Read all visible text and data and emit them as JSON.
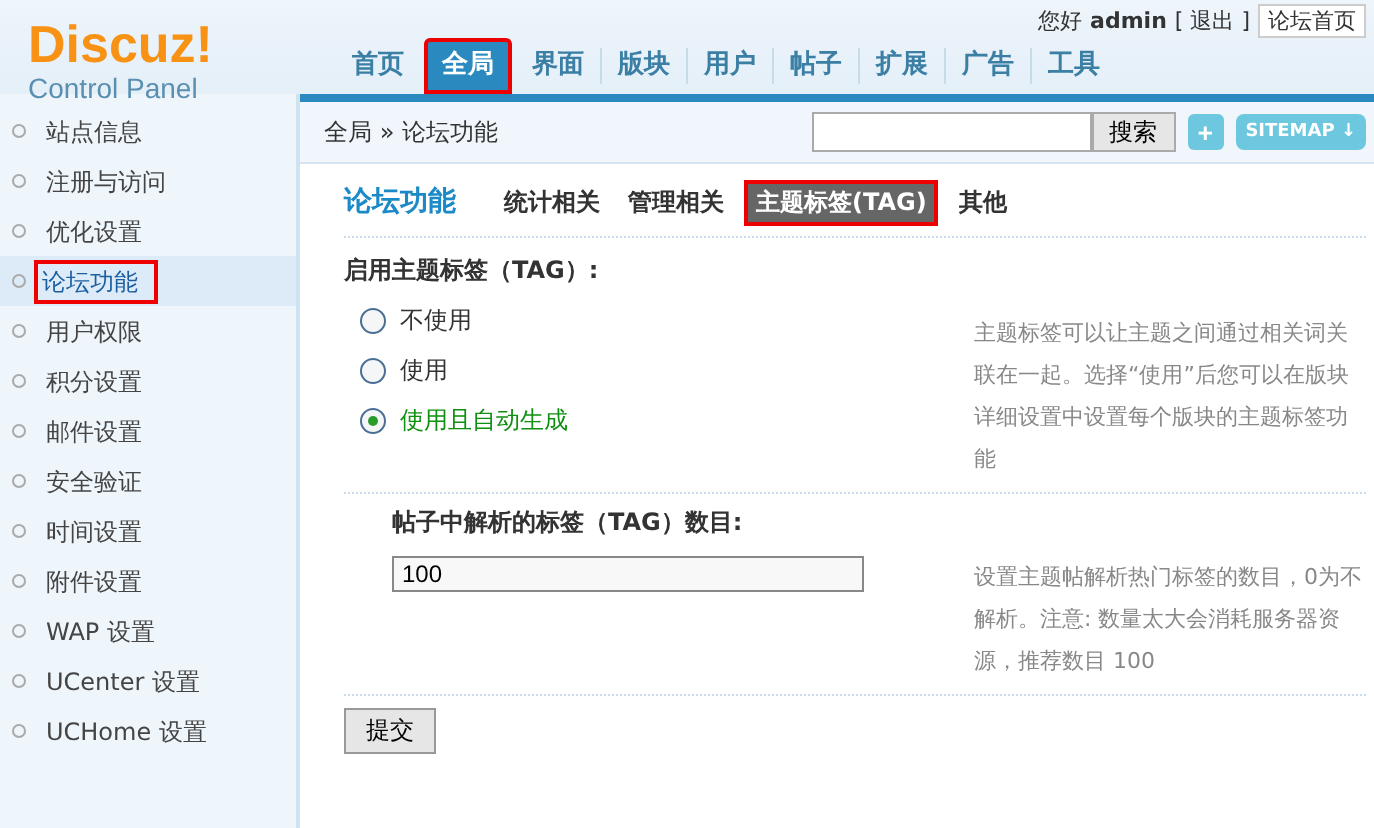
{
  "logo": {
    "title": "Discuz!",
    "subtitle": "Control Panel"
  },
  "nav_tabs": [
    {
      "label": "首页",
      "selected": false
    },
    {
      "label": "全局",
      "selected": true
    },
    {
      "label": "界面",
      "selected": false
    },
    {
      "label": "版块",
      "selected": false
    },
    {
      "label": "用户",
      "selected": false
    },
    {
      "label": "帖子",
      "selected": false
    },
    {
      "label": "扩展",
      "selected": false
    },
    {
      "label": "广告",
      "selected": false
    },
    {
      "label": "工具",
      "selected": false
    }
  ],
  "user_bar": {
    "greeting": "您好",
    "username": "admin",
    "logout": "[ 退出 ]",
    "forum_home": "论坛首页"
  },
  "breadcrumb": "全局 » 论坛功能",
  "search": {
    "button": "搜索"
  },
  "plus_button": "+",
  "sitemap_button": "SITEMAP ↓",
  "sidebar": {
    "items": [
      {
        "label": "站点信息",
        "selected": false
      },
      {
        "label": "注册与访问",
        "selected": false
      },
      {
        "label": "优化设置",
        "selected": false
      },
      {
        "label": "论坛功能",
        "selected": true
      },
      {
        "label": "用户权限",
        "selected": false
      },
      {
        "label": "积分设置",
        "selected": false
      },
      {
        "label": "邮件设置",
        "selected": false
      },
      {
        "label": "安全验证",
        "selected": false
      },
      {
        "label": "时间设置",
        "selected": false
      },
      {
        "label": "附件设置",
        "selected": false
      },
      {
        "label": "WAP 设置",
        "selected": false
      },
      {
        "label": "UCenter 设置",
        "selected": false
      },
      {
        "label": "UCHome 设置",
        "selected": false
      }
    ]
  },
  "page_title": "论坛功能",
  "sub_tabs": [
    {
      "label": "统计相关",
      "selected": false
    },
    {
      "label": "管理相关",
      "selected": false
    },
    {
      "label": "主题标签(TAG)",
      "selected": true
    },
    {
      "label": "其他",
      "selected": false
    }
  ],
  "settings": [
    {
      "label": "启用主题标签（TAG）:",
      "kind": "radio",
      "options": [
        {
          "label": "不使用",
          "selected": false
        },
        {
          "label": "使用",
          "selected": false
        },
        {
          "label": "使用且自动生成",
          "selected": true
        }
      ],
      "description": "主题标签可以让主题之间通过相关词关联在一起。选择“使用”后您可以在版块详细设置中设置每个版块的主题标签功能"
    },
    {
      "label": "帖子中解析的标签（TAG）数目:",
      "kind": "text",
      "value": "100",
      "description": "设置主题帖解析热门标签的数目，0为不解析。注意: 数量太大会消耗服务器资源，推荐数目 100"
    }
  ],
  "submit_button": "提交"
}
